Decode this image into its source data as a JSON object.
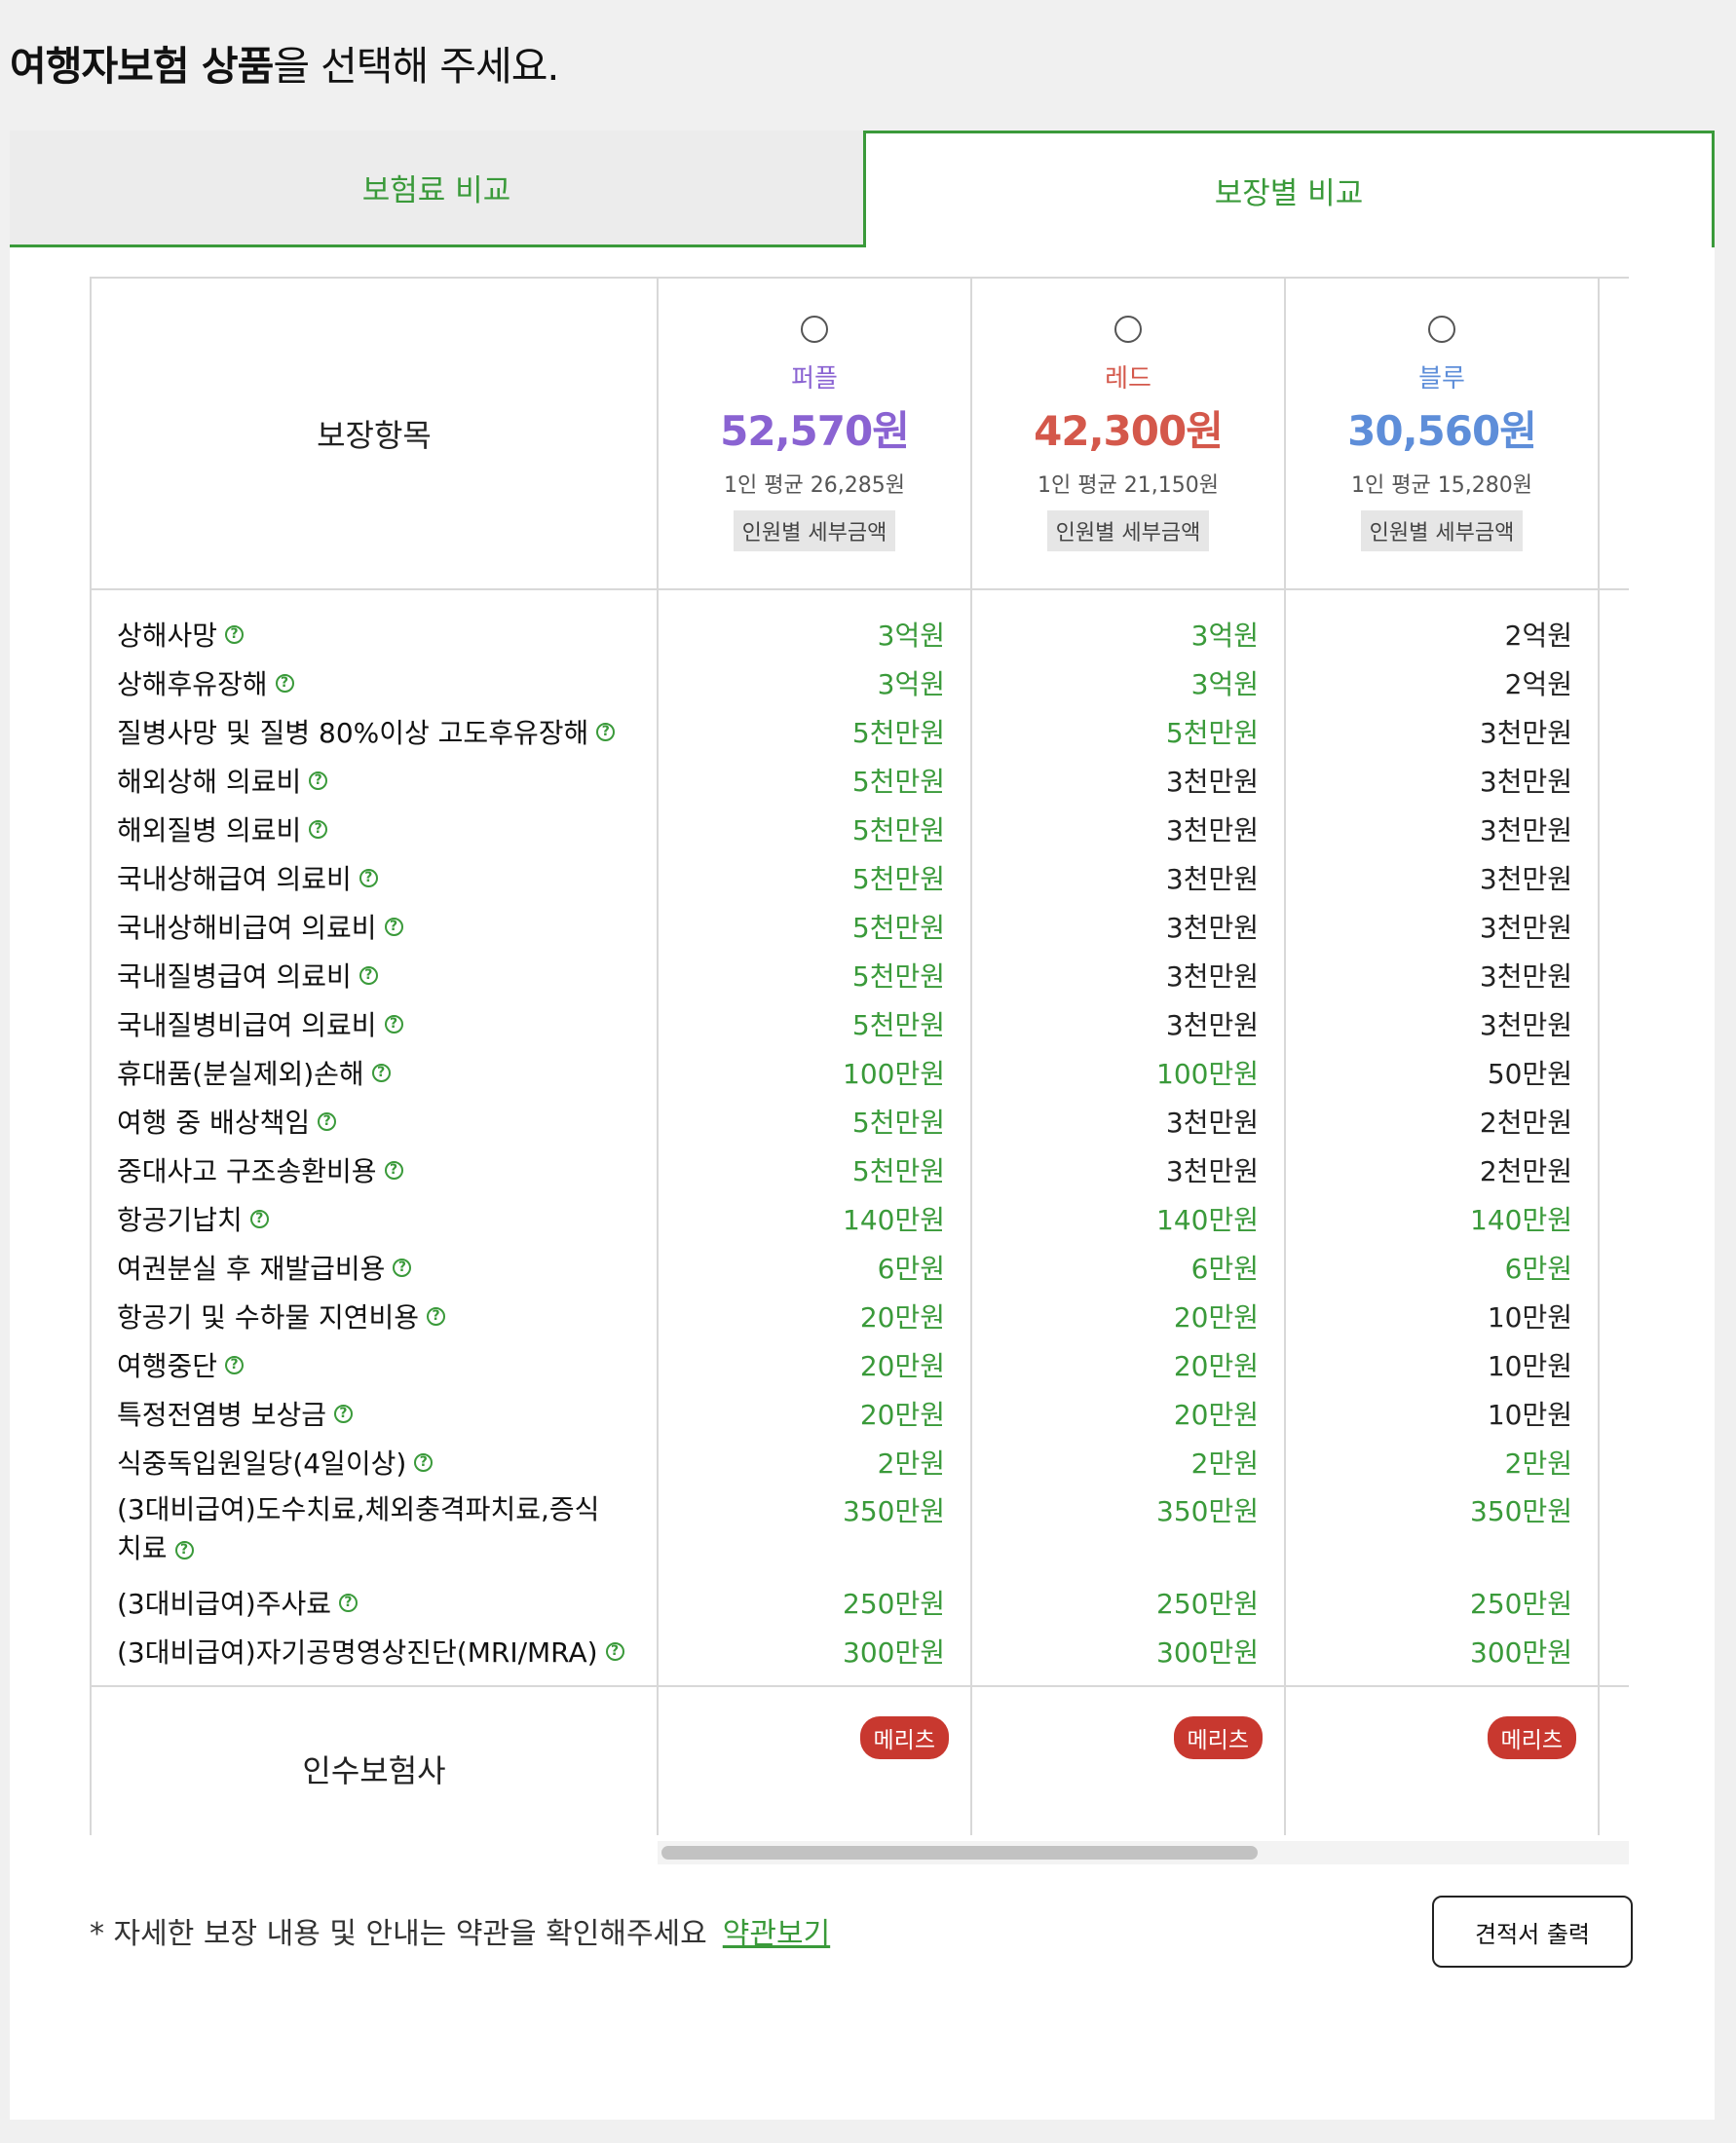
{
  "page": {
    "title_bold": "여행자보험 상품",
    "title_rest": "을 선택해 주세요."
  },
  "tabs": [
    {
      "label": "보험료 비교",
      "active": false
    },
    {
      "label": "보장별 비교",
      "active": true
    }
  ],
  "table": {
    "header_label": "보장항목",
    "plans": [
      {
        "name": "퍼플",
        "price": "52,570원",
        "avg": "1인 평균 26,285원",
        "detail": "인원별 세부금액",
        "color": "#8a63d2"
      },
      {
        "name": "레드",
        "price": "42,300원",
        "avg": "1인 평균 21,150원",
        "detail": "인원별 세부금액",
        "color": "#d4584b"
      },
      {
        "name": "블루",
        "price": "30,560원",
        "avg": "1인 평균 15,280원",
        "detail": "인원별 세부금액",
        "color": "#5e8ed9"
      }
    ],
    "items": [
      {
        "label": "상해사망",
        "values": [
          "3억원",
          "3억원",
          "2억원"
        ],
        "green": [
          true,
          true,
          false
        ]
      },
      {
        "label": "상해후유장해",
        "values": [
          "3억원",
          "3억원",
          "2억원"
        ],
        "green": [
          true,
          true,
          false
        ]
      },
      {
        "label": "질병사망 및 질병 80%이상 고도후유장해",
        "values": [
          "5천만원",
          "5천만원",
          "3천만원"
        ],
        "green": [
          true,
          true,
          false
        ]
      },
      {
        "label": "해외상해 의료비",
        "values": [
          "5천만원",
          "3천만원",
          "3천만원"
        ],
        "green": [
          true,
          false,
          false
        ]
      },
      {
        "label": "해외질병 의료비",
        "values": [
          "5천만원",
          "3천만원",
          "3천만원"
        ],
        "green": [
          true,
          false,
          false
        ]
      },
      {
        "label": "국내상해급여 의료비",
        "values": [
          "5천만원",
          "3천만원",
          "3천만원"
        ],
        "green": [
          true,
          false,
          false
        ]
      },
      {
        "label": "국내상해비급여 의료비",
        "values": [
          "5천만원",
          "3천만원",
          "3천만원"
        ],
        "green": [
          true,
          false,
          false
        ]
      },
      {
        "label": "국내질병급여 의료비",
        "values": [
          "5천만원",
          "3천만원",
          "3천만원"
        ],
        "green": [
          true,
          false,
          false
        ]
      },
      {
        "label": "국내질병비급여 의료비",
        "values": [
          "5천만원",
          "3천만원",
          "3천만원"
        ],
        "green": [
          true,
          false,
          false
        ]
      },
      {
        "label": "휴대품(분실제외)손해",
        "values": [
          "100만원",
          "100만원",
          "50만원"
        ],
        "green": [
          true,
          true,
          false
        ]
      },
      {
        "label": "여행 중 배상책임",
        "values": [
          "5천만원",
          "3천만원",
          "2천만원"
        ],
        "green": [
          true,
          false,
          false
        ]
      },
      {
        "label": "중대사고 구조송환비용",
        "values": [
          "5천만원",
          "3천만원",
          "2천만원"
        ],
        "green": [
          true,
          false,
          false
        ]
      },
      {
        "label": "항공기납치",
        "values": [
          "140만원",
          "140만원",
          "140만원"
        ],
        "green": [
          true,
          true,
          true
        ]
      },
      {
        "label": "여권분실 후 재발급비용",
        "values": [
          "6만원",
          "6만원",
          "6만원"
        ],
        "green": [
          true,
          true,
          true
        ]
      },
      {
        "label": "항공기 및 수하물 지연비용",
        "values": [
          "20만원",
          "20만원",
          "10만원"
        ],
        "green": [
          true,
          true,
          false
        ]
      },
      {
        "label": "여행중단",
        "values": [
          "20만원",
          "20만원",
          "10만원"
        ],
        "green": [
          true,
          true,
          false
        ]
      },
      {
        "label": "특정전염병 보상금",
        "values": [
          "20만원",
          "20만원",
          "10만원"
        ],
        "green": [
          true,
          true,
          false
        ]
      },
      {
        "label": "식중독입원일당(4일이상)",
        "values": [
          "2만원",
          "2만원",
          "2만원"
        ],
        "green": [
          true,
          true,
          true
        ]
      },
      {
        "label": "(3대비급여)도수치료,체외충격파치료,증식치료",
        "values": [
          "350만원",
          "350만원",
          "350만원"
        ],
        "green": [
          true,
          true,
          true
        ],
        "tall": true
      },
      {
        "label": "(3대비급여)주사료",
        "values": [
          "250만원",
          "250만원",
          "250만원"
        ],
        "green": [
          true,
          true,
          true
        ]
      },
      {
        "label": "(3대비급여)자기공명영상진단(MRI/MRA)",
        "values": [
          "300만원",
          "300만원",
          "300만원"
        ],
        "green": [
          true,
          true,
          true
        ]
      }
    ],
    "insurer_label": "인수보험사",
    "insurer_badges": [
      "메리츠",
      "메리츠",
      "메리츠"
    ],
    "help_icon": "question-circle-icon"
  },
  "footer": {
    "note": "* 자세한 보장 내용 및 안내는 약관을 확인해주세요",
    "terms_link": "약관보기",
    "print_button": "견적서 출력"
  }
}
